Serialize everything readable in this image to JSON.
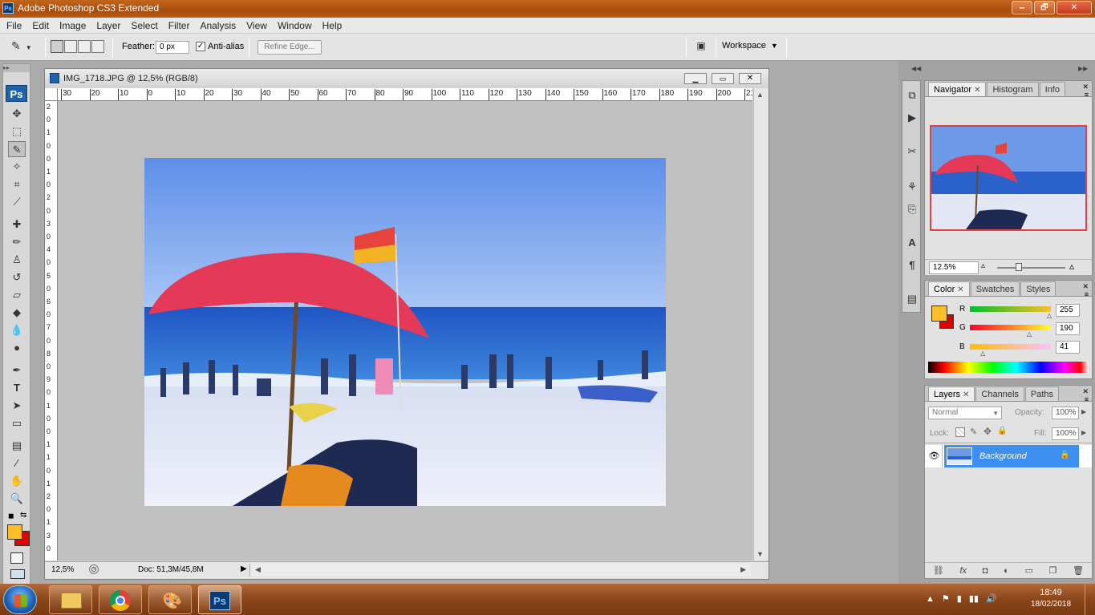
{
  "window": {
    "title": "Adobe Photoshop CS3 Extended",
    "app_icon": "Ps",
    "minimize": "🗕",
    "restore": "🗗",
    "close": "✕"
  },
  "menu": [
    "File",
    "Edit",
    "Image",
    "Layer",
    "Select",
    "Filter",
    "Analysis",
    "View",
    "Window",
    "Help"
  ],
  "options": {
    "feather_label": "Feather:",
    "feather_value": "0 px",
    "antialias_label": "Anti-alias",
    "antialias_checked": true,
    "refine_edge_label": "Refine Edge...",
    "workspace_label": "Workspace"
  },
  "toolbox": {
    "logo": "Ps"
  },
  "document": {
    "title": "IMG_1718.JPG @ 12,5% (RGB/8)",
    "ruler_ticks": [
      "30",
      "20",
      "10",
      "0",
      "10",
      "20",
      "30",
      "40",
      "50",
      "60",
      "70",
      "80",
      "90",
      "100",
      "110",
      "120",
      "130",
      "140",
      "150",
      "160",
      "170",
      "180",
      "190",
      "200",
      "21"
    ],
    "vruler_ticks": [
      "2",
      "0",
      "1",
      "0",
      "0",
      "1",
      "0",
      "2",
      "0",
      "3",
      "0",
      "4",
      "0",
      "5",
      "0",
      "6",
      "0",
      "7",
      "0",
      "8",
      "0",
      "9",
      "0",
      "1",
      "0",
      "0",
      "1",
      "1",
      "0",
      "1",
      "2",
      "0",
      "1",
      "3",
      "0"
    ],
    "zoom": "12,5%",
    "doc_size": "Doc: 51,3M/45,8M"
  },
  "navigator": {
    "tabs": [
      "Navigator",
      "Histogram",
      "Info"
    ],
    "zoom": "12.5%"
  },
  "color": {
    "tabs": [
      "Color",
      "Swatches",
      "Styles"
    ],
    "r_label": "R",
    "r_value": "255",
    "g_label": "G",
    "g_value": "190",
    "b_label": "B",
    "b_value": "41",
    "foreground": "#ffbe29",
    "background": "#e00000"
  },
  "layers": {
    "tabs": [
      "Layers",
      "Channels",
      "Paths"
    ],
    "blend_mode": "Normal",
    "opacity_label": "Opacity:",
    "opacity_value": "100%",
    "lock_label": "Lock:",
    "fill_label": "Fill:",
    "fill_value": "100%",
    "items": [
      {
        "name": "Background",
        "visible": true,
        "locked": true
      }
    ]
  },
  "taskbar": {
    "time": "18:49",
    "date": "18/02/2018"
  }
}
